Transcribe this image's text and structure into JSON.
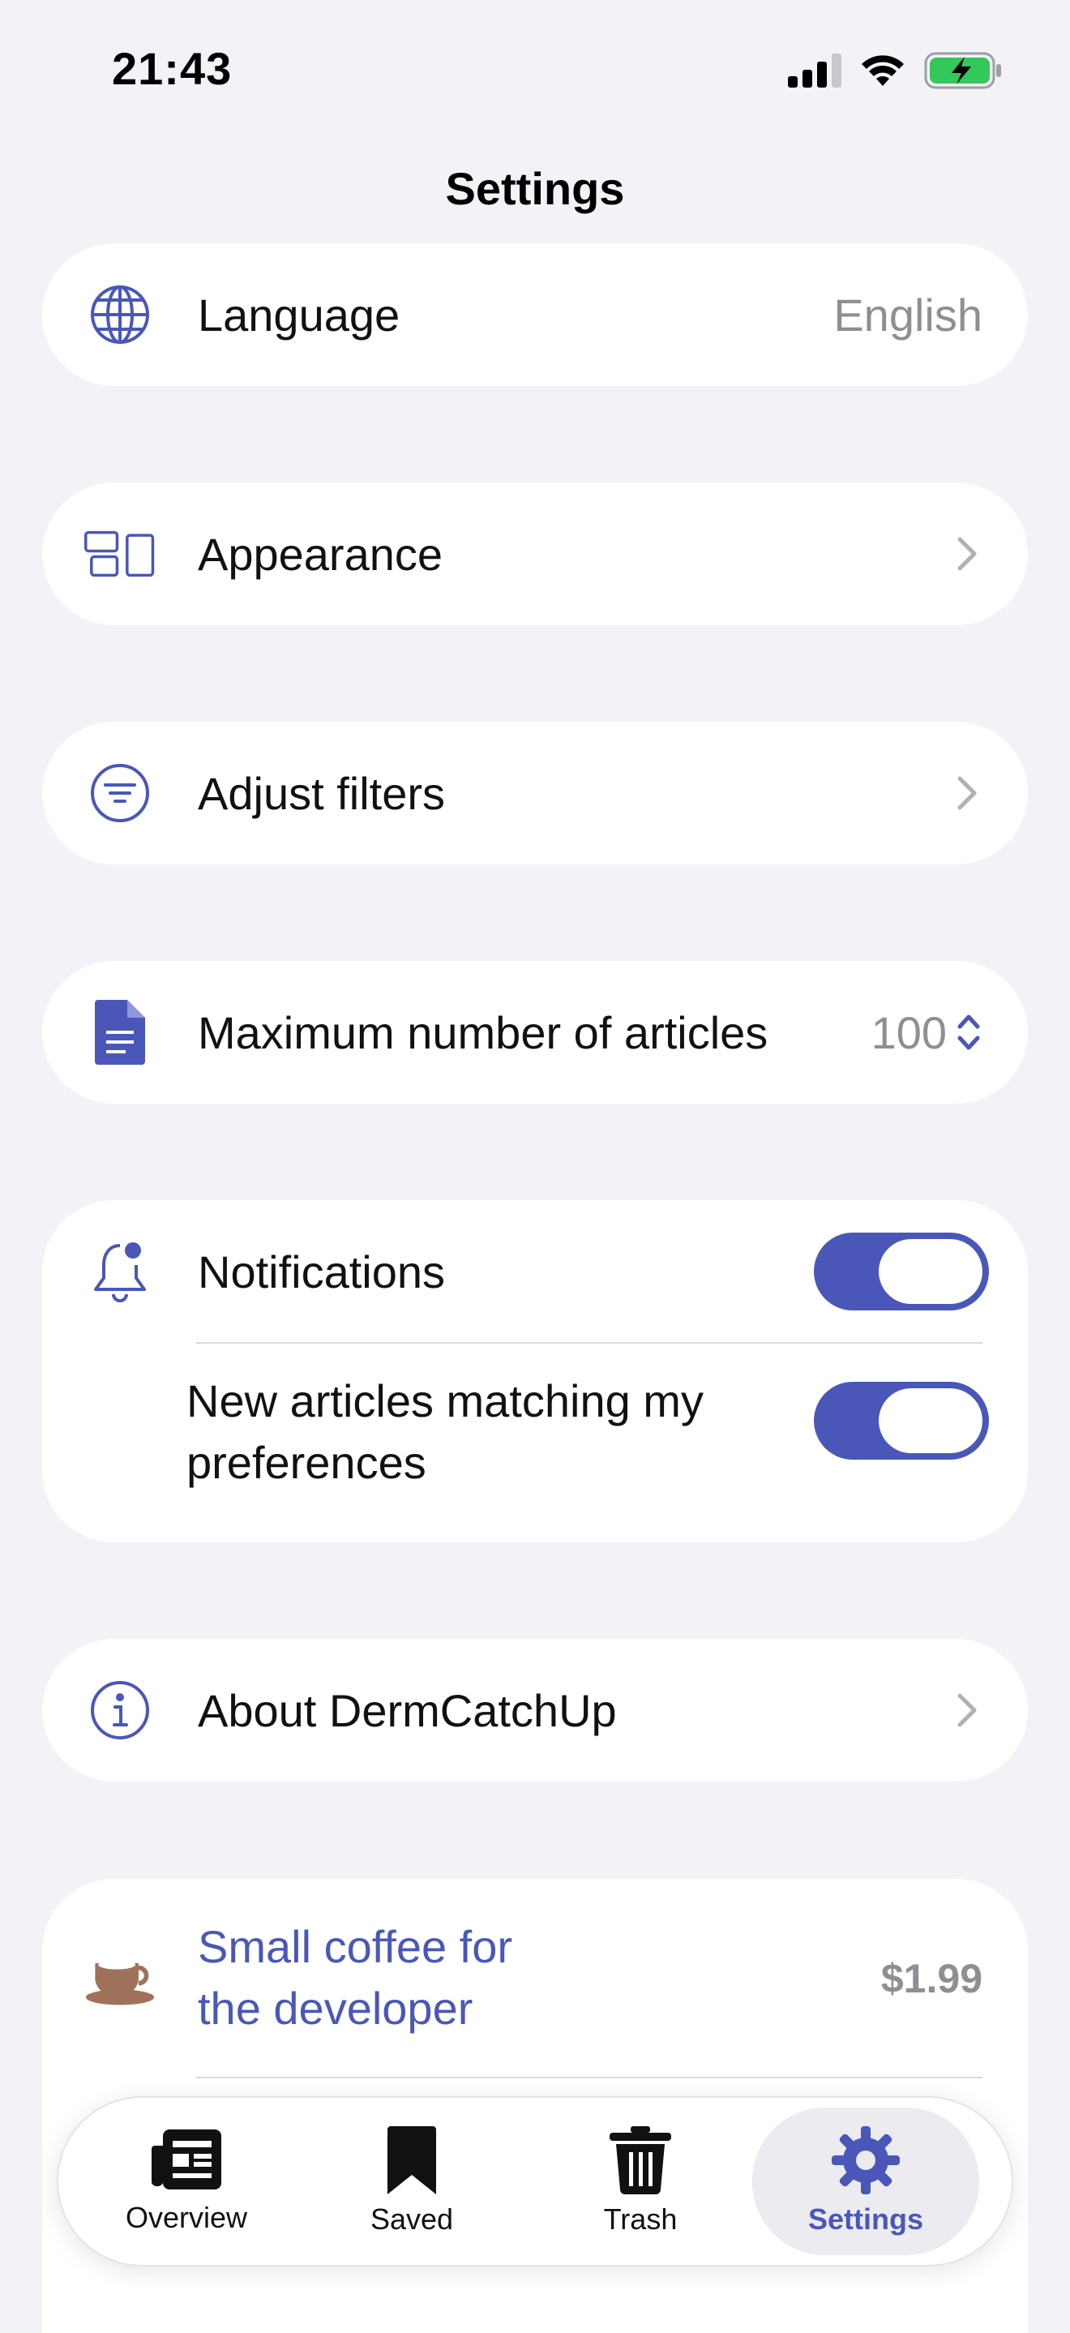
{
  "status": {
    "time": "21:43"
  },
  "colors": {
    "accent": "#4a57b8",
    "background": "#f2f2f7",
    "card": "#ffffff",
    "secondary_text": "#8e8e93",
    "coffee": "#a0715a"
  },
  "header": {
    "title": "Settings"
  },
  "settings": {
    "language": {
      "label": "Language",
      "value": "English",
      "icon": "globe-icon"
    },
    "appearance": {
      "label": "Appearance",
      "icon": "layout-icon"
    },
    "filters": {
      "label": "Adjust filters",
      "icon": "filter-icon"
    },
    "max_articles": {
      "label": "Maximum number of articles",
      "value": "100",
      "icon": "document-icon"
    },
    "notifications": {
      "label": "Notifications",
      "enabled": true,
      "icon": "bell-icon"
    },
    "new_articles": {
      "line1": "New articles matching my",
      "line2": "preferences",
      "enabled": true
    },
    "about": {
      "label": "About DermCatchUp",
      "icon": "info-icon"
    },
    "coffee": {
      "line1": "Small coffee for",
      "line2": "the developer",
      "price": "$1.99",
      "icon": "coffee-cup-icon"
    }
  },
  "tabbar": {
    "tabs": [
      {
        "label": "Overview",
        "icon": "newspaper-icon"
      },
      {
        "label": "Saved",
        "icon": "bookmark-icon"
      },
      {
        "label": "Trash",
        "icon": "trash-icon"
      },
      {
        "label": "Settings",
        "icon": "gear-icon",
        "active": true
      }
    ]
  }
}
